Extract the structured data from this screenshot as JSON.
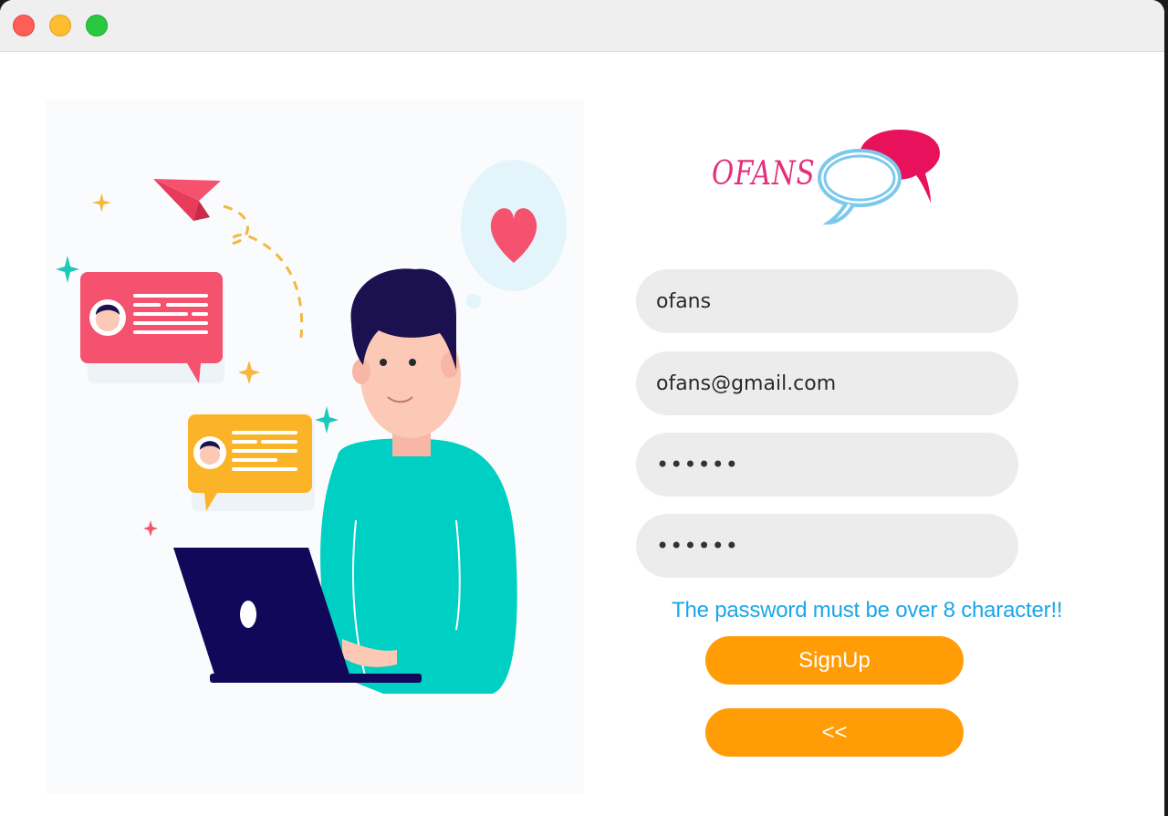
{
  "window": {
    "controls": [
      "close",
      "minimize",
      "zoom"
    ]
  },
  "logo": {
    "text": "OFANS",
    "primary_color": "#e4307c",
    "bubble_colors": [
      "#7cc9ec",
      "#e8125c"
    ]
  },
  "form": {
    "username": "ofans",
    "email": "ofans@gmail.com",
    "password_masked": "••••••",
    "confirm_password_masked": "••••••",
    "warning": "The password must be over 8 character!!",
    "signup_label": "SignUp",
    "back_label": "<<"
  },
  "colors": {
    "button": "#ff9c06",
    "warning": "#1aa6e8",
    "field_bg": "#ececec"
  }
}
